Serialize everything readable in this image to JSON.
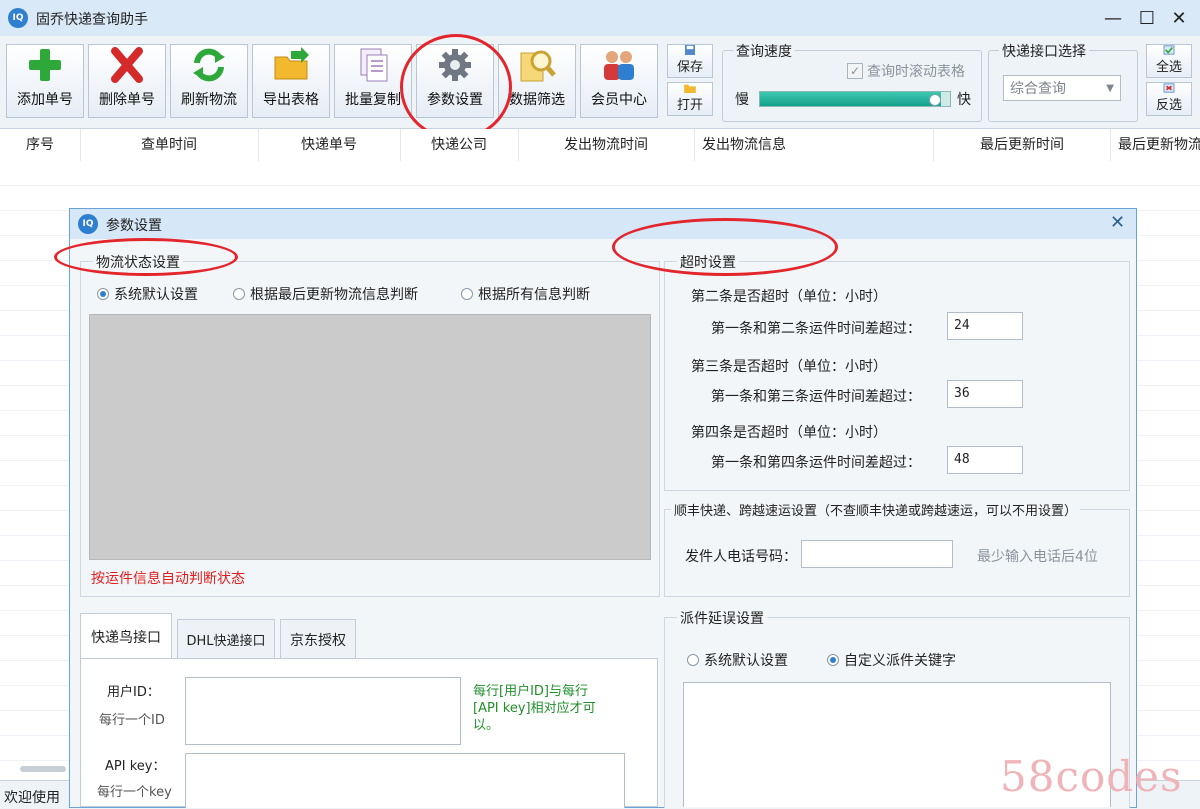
{
  "window": {
    "title": "固乔快递查询助手",
    "icon_text": "IQ"
  },
  "toolbar": {
    "buttons": [
      {
        "label": "添加单号",
        "icon": "plus-icon"
      },
      {
        "label": "删除单号",
        "icon": "delete-x-icon"
      },
      {
        "label": "刷新物流",
        "icon": "refresh-icon"
      },
      {
        "label": "导出表格",
        "icon": "folder-export-icon"
      },
      {
        "label": "批量复制",
        "icon": "copy-icon"
      },
      {
        "label": "参数设置",
        "icon": "gear-icon"
      },
      {
        "label": "数据筛选",
        "icon": "magnifier-icon"
      },
      {
        "label": "会员中心",
        "icon": "users-icon"
      }
    ],
    "save_label": "保存",
    "open_label": "打开",
    "speed": {
      "title": "查询速度",
      "scroll_checkbox": "查询时滚动表格",
      "slow": "慢",
      "fast": "快",
      "value": 0.95
    },
    "interface": {
      "title": "快递接口选择",
      "selected": "综合查询"
    },
    "select_all": "全选",
    "invert": "反选"
  },
  "table": {
    "headers": [
      "序号",
      "查单时间",
      "快递单号",
      "快递公司",
      "发出物流时间",
      "发出物流信息",
      "最后更新时间",
      "最后更新物流"
    ]
  },
  "status": {
    "text": "欢迎使用"
  },
  "dialog": {
    "title": "参数设置",
    "logistics": {
      "title": "物流状态设置",
      "options": [
        "系统默认设置",
        "根据最后更新物流信息判断",
        "根据所有信息判断"
      ],
      "note": "按运件信息自动判断状态"
    },
    "timeout": {
      "title": "超时设置",
      "rows": [
        {
          "heading": "第二条是否超时（单位：小时）",
          "label": "第一条和第二条运件时间差超过：",
          "value": "24"
        },
        {
          "heading": "第三条是否超时（单位：小时）",
          "label": "第一条和第三条运件时间差超过：",
          "value": "36"
        },
        {
          "heading": "第四条是否超时（单位：小时）",
          "label": "第一条和第四条运件时间差超过：",
          "value": "48"
        }
      ]
    },
    "sf": {
      "title": "顺丰快递、跨越速运设置（不查顺丰快递或跨越速运，可以不用设置）",
      "label": "发件人电话号码：",
      "hint": "最少输入电话后4位"
    },
    "tabs": [
      "快递鸟接口",
      "DHL快递接口",
      "京东授权"
    ],
    "kdn": {
      "user_label": "用户ID：",
      "user_sub": "每行一个ID",
      "api_label": "API key：",
      "api_sub": "每行一个key",
      "note": "每行[用户ID]与每行[API key]相对应才可以。"
    },
    "delay": {
      "title": "派件延误设置",
      "options": [
        "系统默认设置",
        "自定义派件关键字"
      ]
    }
  },
  "watermark": "58codes"
}
